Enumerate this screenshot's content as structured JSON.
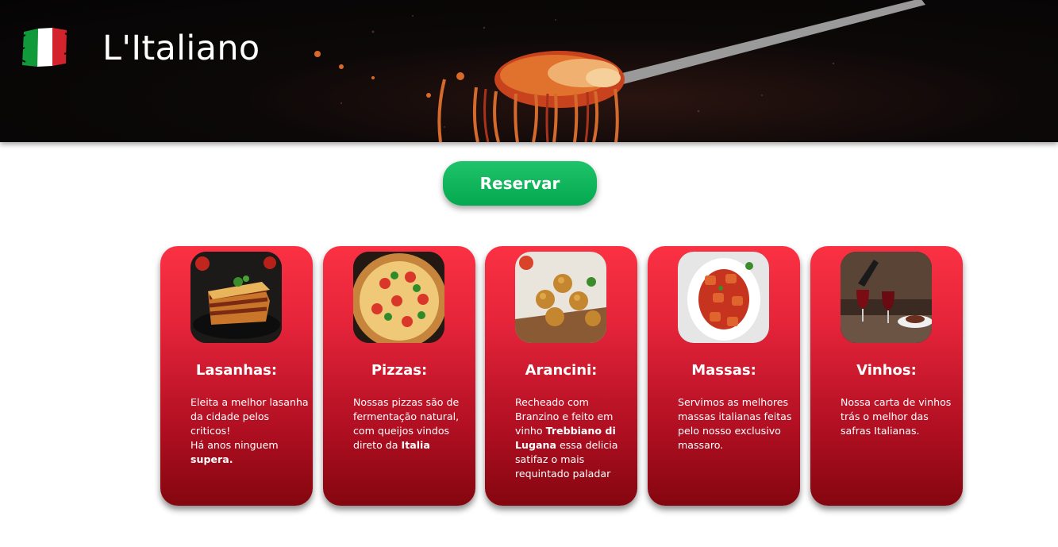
{
  "header": {
    "brand": "L'Italiano",
    "flag_colors": [
      "#119a3a",
      "#ffffff",
      "#d3232c"
    ]
  },
  "reserve_button": {
    "label": "Reservar",
    "color": "#04a84e"
  },
  "cards": [
    {
      "title": "Lasanhas:",
      "image": "lasagna-photo",
      "desc": [
        {
          "text": "Eleita a melhor lasanha da cidade pelos criticos!",
          "bold": false
        },
        {
          "text": "Há anos ninguem ",
          "bold": false,
          "br_before": true
        },
        {
          "text": "supera.",
          "bold": true
        }
      ]
    },
    {
      "title": "Pizzas:",
      "image": "pizza-photo",
      "desc": [
        {
          "text": "Nossas pizzas são de fermentação natural, com queijos vindos direto da ",
          "bold": false
        },
        {
          "text": "Italia",
          "bold": true
        }
      ]
    },
    {
      "title": "Arancini:",
      "image": "arancini-photo",
      "desc": [
        {
          "text": "Recheado com Branzino e feito em vinho ",
          "bold": false
        },
        {
          "text": "Trebbiano di Lugana",
          "bold": true
        },
        {
          "text": " essa delicia satifaz o mais requintado paladar",
          "bold": false
        }
      ]
    },
    {
      "title": "Massas:",
      "image": "pasta-photo",
      "desc": [
        {
          "text": "Servimos as melhores massas italianas feitas pelo nosso exclusivo massaro.",
          "bold": false
        }
      ]
    },
    {
      "title": "Vinhos:",
      "image": "wine-photo",
      "desc": [
        {
          "text": "Nossa carta de vinhos trás o melhor das safras Italianas.",
          "bold": false
        }
      ]
    }
  ],
  "card_colors": {
    "top": "#fb3143",
    "bottom": "#84060f"
  }
}
